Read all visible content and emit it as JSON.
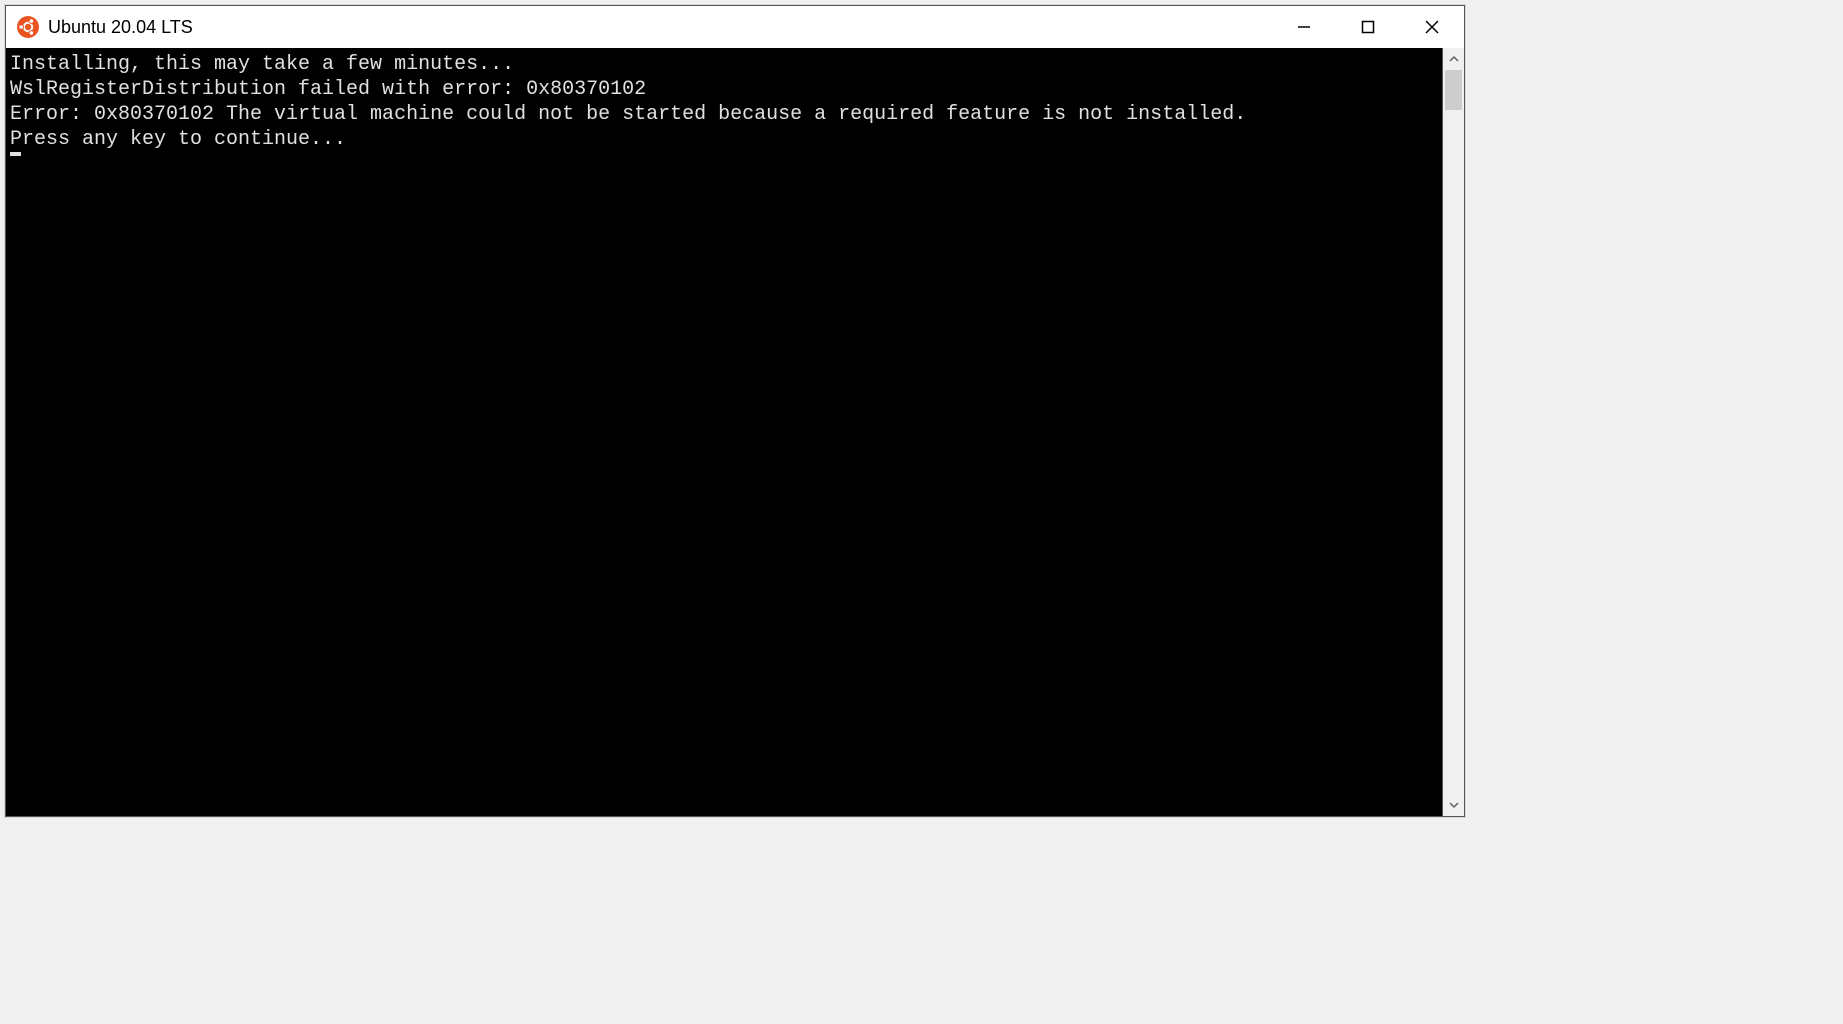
{
  "window": {
    "title": "Ubuntu 20.04 LTS",
    "icon": "ubuntu-icon",
    "colors": {
      "ubuntu_orange": "#E95420",
      "ubuntu_inner": "#ffffff"
    }
  },
  "terminal": {
    "lines": [
      "Installing, this may take a few minutes...",
      "WslRegisterDistribution failed with error: 0x80370102",
      "Error: 0x80370102 The virtual machine could not be started because a required feature is not installed.",
      "",
      "Press any key to continue..."
    ]
  }
}
